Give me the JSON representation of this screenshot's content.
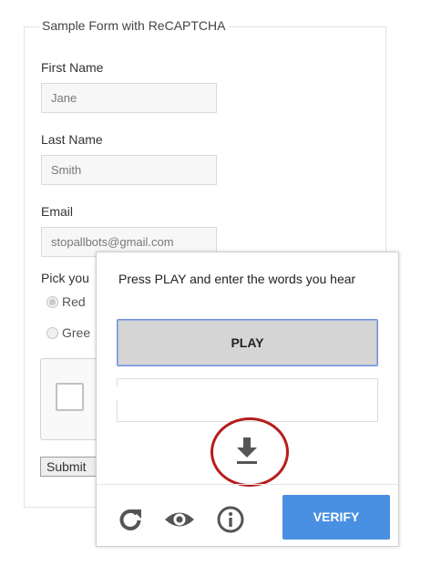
{
  "form": {
    "legend": "Sample Form with ReCAPTCHA",
    "first_name": {
      "label": "First Name",
      "value": "Jane"
    },
    "last_name": {
      "label": "Last Name",
      "value": "Smith"
    },
    "email": {
      "label": "Email",
      "value": "stopallbots@gmail.com"
    },
    "pick_label": "Pick you",
    "radios": [
      {
        "label": "Red",
        "checked": true
      },
      {
        "label": "Gree",
        "checked": false
      }
    ],
    "submit_label": "Submit"
  },
  "captcha_challenge": {
    "instructions": "Press PLAY and enter the words you hear",
    "play_label": "PLAY",
    "answer_value": "",
    "verify_label": "VERIFY",
    "icons": [
      "download-icon",
      "reload-icon",
      "visual-challenge-icon",
      "info-icon"
    ],
    "accent_color": "#4a90e2",
    "highlight_color": "#b71c1c"
  }
}
